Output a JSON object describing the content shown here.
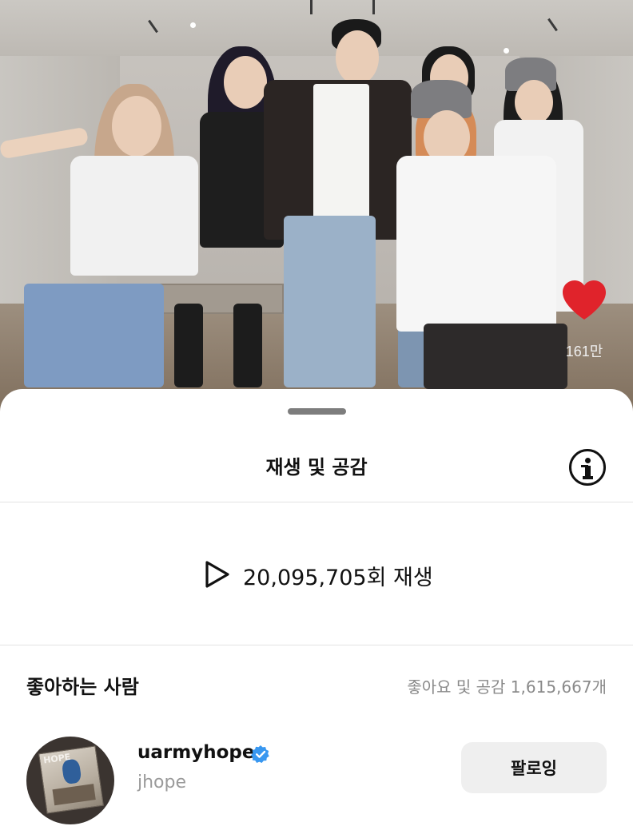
{
  "video": {
    "like_count": "161만"
  },
  "sheet": {
    "title": "재생 및 공감",
    "info_icon": "info-circle-icon"
  },
  "plays": {
    "icon": "play-icon",
    "text": "20,095,705회 재생"
  },
  "likers": {
    "title": "좋아하는 사람",
    "count_text": "좋아요 및 공감 1,615,667개",
    "users": [
      {
        "username": "uarmyhope",
        "verified": true,
        "display_name": "jhope",
        "button_label": "팔로잉",
        "avatar_text": "HOPE"
      }
    ]
  },
  "colors": {
    "heart": "#e0232b",
    "verified": "#3897f0",
    "button_bg": "#efefef",
    "muted_text": "#8a8a8a"
  }
}
